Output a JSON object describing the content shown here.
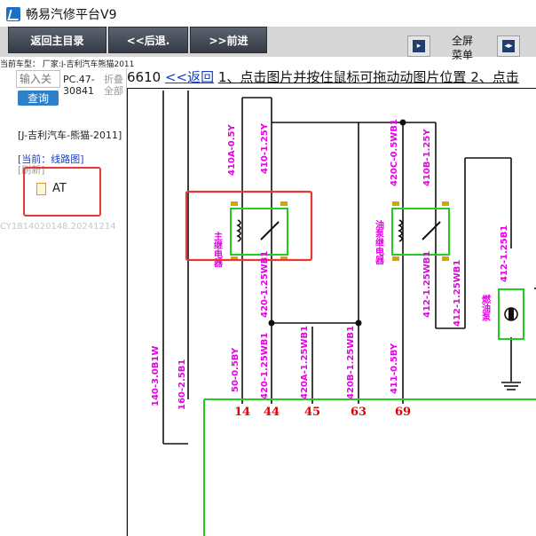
{
  "app": {
    "title": "畅易汽修平台V9"
  },
  "toolbar": {
    "home_label": "返回主目录",
    "back_label": "<<后退.",
    "forward_label": ">>前进",
    "fullscreen_label": "全屏",
    "menu_label": "菜单",
    "expand_icon": "expand-icon",
    "shrink_icon": "shrink-icon"
  },
  "vehicle": {
    "line": "当前车型： 厂家:J-吉利汽车熊猫2011"
  },
  "sidebar": {
    "search_placeholder": "输入关",
    "query_label": "查询",
    "code_line1": "PC.47-",
    "code_line2": "30841",
    "fold_line1": "折叠",
    "fold_line2": "全部",
    "model_text": "[J-吉利汽车-熊猫-2011]",
    "current_link": "[当前：线路图]",
    "refresh_link": "[刷新]",
    "tree_item": "AT",
    "watermark": "CY1814020148.20241214"
  },
  "content": {
    "doc_id": "6610",
    "back_link": "<<返回",
    "instruction": "1、点击图片并按住鼠标可拖动动图片位置 2、点击"
  },
  "diagram": {
    "relay1_label": "主继电器",
    "relay2_label": "油泵继电器",
    "pump_label": "燃油泵",
    "wire_labels": [
      "140-3.0B1W",
      "160-2.5B1",
      "410A-0.5Y",
      "410-1.25Y",
      "420-1.25WB1",
      "50-0.5BY",
      "420-1.25WB1",
      "420A-1.25WB1",
      "420B-1.25WB1",
      "420C-0.5WB1",
      "410B-1.25Y",
      "411-0.5BY",
      "412-1.25WB1",
      "412-1.25WB1",
      "412-1.25B1"
    ],
    "pin_labels": [
      "14",
      "44",
      "45",
      "63",
      "69"
    ],
    "colors": {
      "wire_label": "#e600e6",
      "relay": "#22cc22",
      "pin_label": "#e60000",
      "highlight": "#e53935",
      "connector": "#d4a800"
    }
  }
}
